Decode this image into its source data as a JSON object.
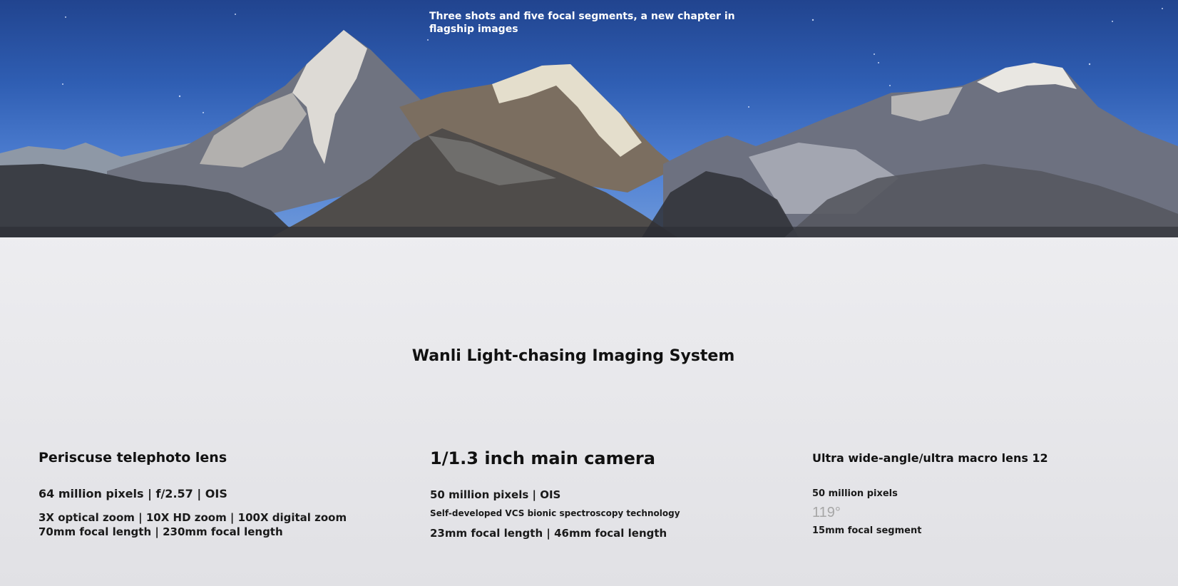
{
  "hero": {
    "caption": "Three shots and five focal segments, a new chapter in flagship images"
  },
  "section": {
    "title": "Wanli Light-chasing Imaging System"
  },
  "lenses": [
    {
      "heading": "Periscuse telephoto lens",
      "lines": [
        "64 million pixels | f/2.57 | OIS",
        "3X optical zoom | 10X HD zoom | 100X digital zoom",
        "70mm focal length | 230mm focal length"
      ]
    },
    {
      "heading": "1/1.3 inch main camera",
      "lines": [
        "50 million pixels | OIS",
        "Self-developed VCS bionic spectroscopy technology",
        "23mm focal length | 46mm focal length"
      ]
    },
    {
      "heading": "Ultra wide-angle/ultra macro lens 12",
      "lines": [
        "50 million pixels",
        "119°",
        "15mm focal segment"
      ]
    }
  ],
  "colors": {
    "sky_top": "#21448f",
    "sky_bottom": "#6e99da",
    "text": "#111111",
    "angle_gray": "#a6a6a6"
  }
}
